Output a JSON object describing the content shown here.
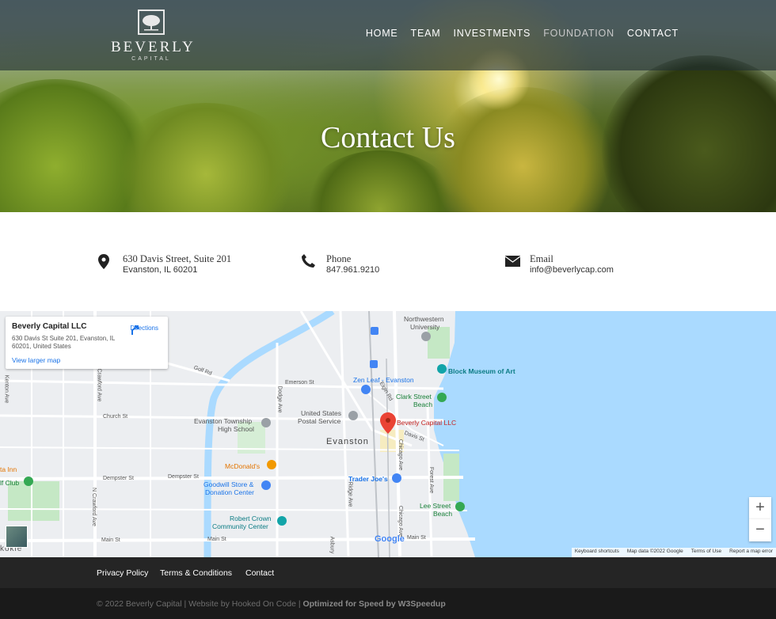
{
  "brand": {
    "name": "BEVERLY",
    "sub": "CAPITAL"
  },
  "nav": {
    "items": [
      "HOME",
      "TEAM",
      "INVESTMENTS",
      "FOUNDATION",
      "CONTACT"
    ],
    "active": "FOUNDATION"
  },
  "hero": {
    "title": "Contact Us"
  },
  "contact": {
    "address": {
      "line1": "630 Davis Street, Suite 201",
      "line2": "Evanston, IL 60201"
    },
    "phone": {
      "label": "Phone",
      "value": "847.961.9210"
    },
    "email": {
      "label": "Email",
      "value": "info@beverlycap.com"
    }
  },
  "map_card": {
    "name": "Beverly Capital LLC",
    "address": "630 Davis St Suite 201, Evanston, IL 60201, United States",
    "directions": "Directions",
    "larger": "View larger map"
  },
  "map_labels": {
    "northwestern": "Northwestern",
    "university": "University",
    "block_museum": "Block Museum of Art",
    "zen_leaf": "Zen Leaf - Evanston",
    "clark_beach_1": "Clark Street",
    "clark_beach_2": "Beach",
    "usps_1": "United States",
    "usps_2": "Postal Service",
    "beverly_pin": "Beverly Capital LLC",
    "township_1": "Evanston Township",
    "township_2": "High School",
    "evanston": "Evanston",
    "mcdonalds": "McDonald's",
    "trader_joes": "Trader Joe's",
    "goodwill_1": "Goodwill Store &",
    "goodwill_2": "Donation Center",
    "lee_beach_1": "Lee Street",
    "lee_beach_2": "Beach",
    "robert_crown_1": "Robert Crown",
    "robert_crown_2": "Community Center",
    "golf_rd": "Golf Rd",
    "emerson": "Emerson St",
    "church": "Church St",
    "dempster_1": "Dempster St",
    "dempster_2": "Dempster St",
    "main_1": "Main St",
    "main_2": "Main St",
    "main_3": "Main St",
    "davis": "Davis St",
    "elgin": "Elgin Rd",
    "dodge": "Dodge Ave",
    "ridge": "Ridge Ave",
    "chicago_1": "Chicago Ave",
    "chicago_2": "Chicago Ave",
    "forest": "Forest Ave",
    "crawford_1": "Crawford Ave",
    "crawford_2": "N Crawford Ave",
    "kenton": "Kenton Ave",
    "ta_inn": "ta Inn",
    "f_club": "lf Club",
    "kokie": "kokie",
    "asbury": "Asbury"
  },
  "map_attrib": [
    "Keyboard shortcuts",
    "Map data ©2022 Google",
    "Terms of Use",
    "Report a map error"
  ],
  "google": "Google",
  "footer": {
    "links": [
      "Privacy Policy",
      "Terms & Conditions",
      "Contact"
    ],
    "copy": "© 2022 Beverly Capital | Website by Hooked On Code | ",
    "copy_bold": "Optimized for Speed by W3Speedup"
  },
  "colors": {
    "water": "#aadaff",
    "park": "#c5e8c5",
    "pin": "#ea4335",
    "link": "#1a73e8"
  }
}
